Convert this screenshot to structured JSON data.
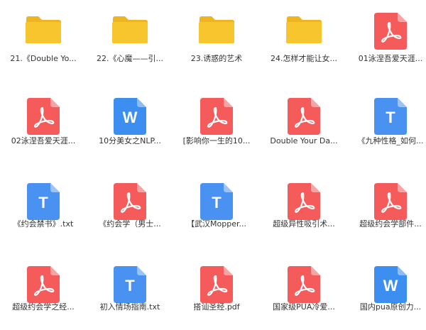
{
  "colors": {
    "folder": "#F7C62F",
    "folder_back": "#EDB522",
    "pdf": "#F55B5B",
    "pdf_fold": "#F9A4A4",
    "word": "#3C8FF1",
    "word_fold": "#8DBDF7",
    "txt": "#4A92F2",
    "txt_fold": "#9AC3F7",
    "label": "#333333"
  },
  "files": [
    {
      "type": "folder",
      "icon": "folder-icon",
      "name": "21.《Double Yo..."
    },
    {
      "type": "folder",
      "icon": "folder-icon",
      "name": "22.《心魔——引..."
    },
    {
      "type": "folder",
      "icon": "folder-icon",
      "name": "23.诱惑的艺术"
    },
    {
      "type": "folder",
      "icon": "folder-icon",
      "name": "24.怎样才能让女..."
    },
    {
      "type": "pdf",
      "icon": "pdf-icon",
      "name": "01泳涅吾爱天涯..."
    },
    {
      "type": "pdf",
      "icon": "pdf-icon",
      "name": "02泳涅吾爱天涯..."
    },
    {
      "type": "word",
      "icon": "word-icon",
      "glyph": "W",
      "name": "10分美女之NLP..."
    },
    {
      "type": "pdf",
      "icon": "pdf-icon",
      "name": "[影响你一生的10..."
    },
    {
      "type": "pdf",
      "icon": "pdf-icon",
      "name": "Double Your Da..."
    },
    {
      "type": "txt",
      "icon": "txt-icon",
      "glyph": "T",
      "name": "《九种性格_如何..."
    },
    {
      "type": "txt",
      "icon": "txt-icon",
      "glyph": "T",
      "name": "《约会禁书》.txt"
    },
    {
      "type": "pdf",
      "icon": "pdf-icon",
      "name": "《约会学（男士..."
    },
    {
      "type": "txt",
      "icon": "txt-icon",
      "glyph": "T",
      "name": "【武汉Mopper..."
    },
    {
      "type": "pdf",
      "icon": "pdf-icon",
      "name": "超级异性吸引术..."
    },
    {
      "type": "pdf",
      "icon": "pdf-icon",
      "name": "超级约会学部件..."
    },
    {
      "type": "pdf",
      "icon": "pdf-icon",
      "name": "超级约会学之经..."
    },
    {
      "type": "txt",
      "icon": "txt-icon",
      "glyph": "T",
      "name": "初入情场指南.txt"
    },
    {
      "type": "pdf",
      "icon": "pdf-icon",
      "name": "搭讪圣经.pdf"
    },
    {
      "type": "pdf",
      "icon": "pdf-icon",
      "name": "国家级PUA冷爱..."
    },
    {
      "type": "word",
      "icon": "word-icon",
      "glyph": "W",
      "name": "国内pua原创力..."
    }
  ]
}
